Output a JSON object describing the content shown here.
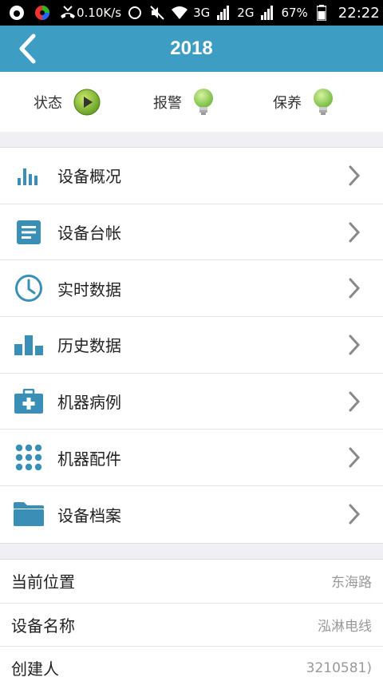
{
  "statusbar": {
    "speed": "0.10K/s",
    "net1": "3G",
    "net2": "2G",
    "battery": "67%",
    "time": "22:22"
  },
  "header": {
    "title": "2018"
  },
  "status": {
    "state_label": "状态",
    "alarm_label": "报警",
    "maintain_label": "保养"
  },
  "menu": {
    "items": [
      {
        "label": "设备概况",
        "icon": "bar-chart-icon"
      },
      {
        "label": "设备台帐",
        "icon": "document-icon"
      },
      {
        "label": "实时数据",
        "icon": "clock-icon"
      },
      {
        "label": "历史数据",
        "icon": "histogram-icon"
      },
      {
        "label": "机器病例",
        "icon": "medical-kit-icon"
      },
      {
        "label": "机器配件",
        "icon": "grid-dots-icon"
      },
      {
        "label": "设备档案",
        "icon": "folder-icon"
      }
    ]
  },
  "info": {
    "rows": [
      {
        "label": "当前位置",
        "value": "东海路"
      },
      {
        "label": "设备名称",
        "value": "泓淋电线"
      },
      {
        "label": "创建人",
        "value": "3210581)"
      }
    ]
  },
  "colors": {
    "primary": "#3e9dc3",
    "icon": "#3a8fb7",
    "green": "#7cc242"
  }
}
